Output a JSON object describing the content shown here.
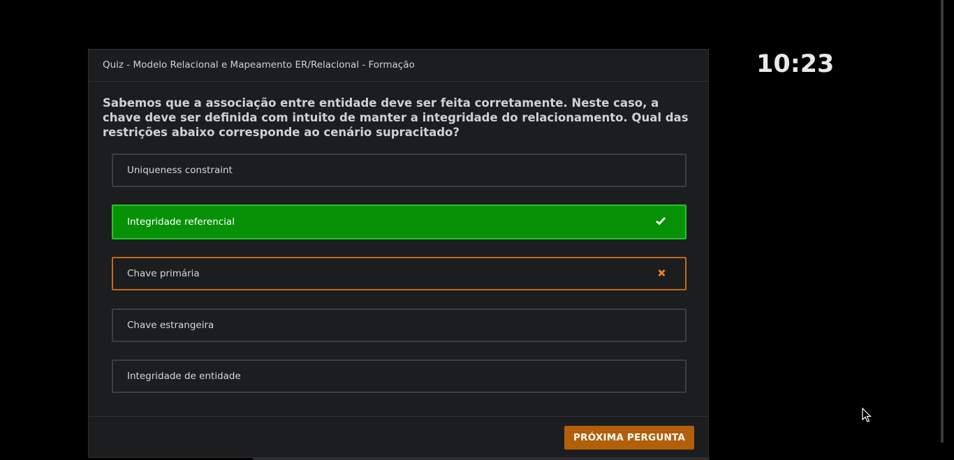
{
  "quiz": {
    "title": "Quiz - Modelo Relacional e Mapeamento ER/Relacional - Formação",
    "question": "Sabemos que a associação entre entidade deve ser feita corretamente. Neste caso, a chave deve ser definida com intuito de manter a integridade do relacionamento. Qual das restrições abaixo corresponde ao cenário supracitado?",
    "options": [
      {
        "label": "Uniqueness constraint",
        "state": "neutral"
      },
      {
        "label": "Integridade referencial",
        "state": "correct",
        "icon": "check-icon"
      },
      {
        "label": "Chave primária",
        "state": "wrong",
        "icon": "x-icon"
      },
      {
        "label": "Chave estrangeira",
        "state": "neutral"
      },
      {
        "label": "Integridade de entidade",
        "state": "neutral"
      }
    ],
    "next_button_label": "PRÓXIMA PERGUNTA"
  },
  "timer": {
    "value": "10:23"
  },
  "colors": {
    "background": "#000000",
    "card": "#1c1d1f",
    "correct": "#079107",
    "wrong_border": "#c16a1a",
    "accent_button": "#b25f0a"
  }
}
